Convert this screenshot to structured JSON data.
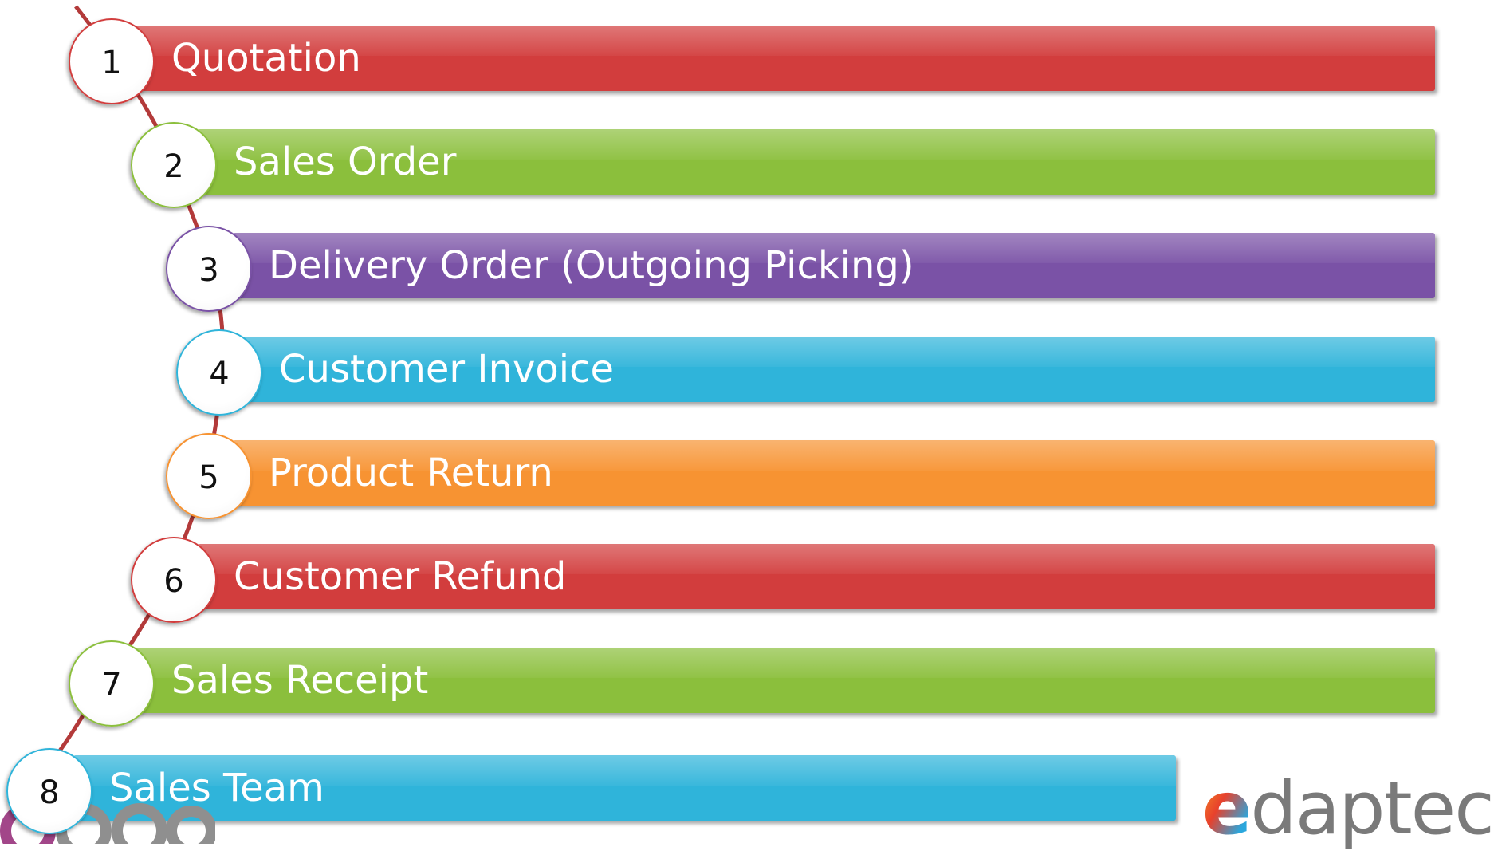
{
  "steps": [
    {
      "number": "1",
      "label": "Quotation",
      "color": "#d23d3d"
    },
    {
      "number": "2",
      "label": "Sales Order",
      "color": "#8bbf3c"
    },
    {
      "number": "3",
      "label": "Delivery Order (Outgoing Picking)",
      "color": "#7a52a6"
    },
    {
      "number": "4",
      "label": "Customer Invoice",
      "color": "#2fb4da"
    },
    {
      "number": "5",
      "label": "Product Return",
      "color": "#f79332"
    },
    {
      "number": "6",
      "label": "Customer Refund",
      "color": "#d23d3d"
    },
    {
      "number": "7",
      "label": "Sales Receipt",
      "color": "#8bbf3c"
    },
    {
      "number": "8",
      "label": "Sales Team",
      "color": "#2fb4da"
    }
  ],
  "logos": {
    "left": {
      "text": "odoo",
      "color": "#a24689"
    },
    "right": {
      "text": "edaptec",
      "color": "#7a7a7a"
    }
  }
}
